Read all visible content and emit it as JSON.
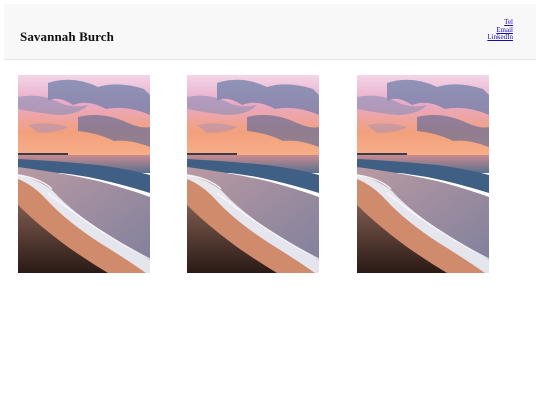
{
  "header": {
    "title": "Savannah Burch",
    "links": [
      {
        "label": "Tel"
      },
      {
        "label": "Email"
      },
      {
        "label": "LinkedIn"
      }
    ]
  },
  "gallery": {
    "photos": [
      {
        "subject": "beach-sunset-photo"
      },
      {
        "subject": "beach-sunset-photo"
      },
      {
        "subject": "beach-sunset-photo"
      }
    ]
  },
  "colors": {
    "header_bg": "#f8f8f8",
    "link": "#1a0dab",
    "title": "#111111"
  }
}
